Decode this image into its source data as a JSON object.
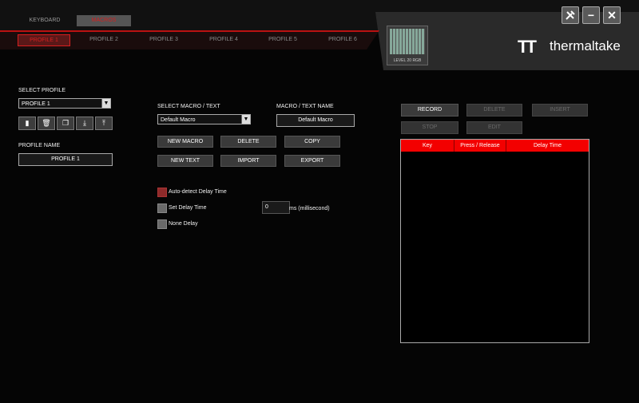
{
  "main_tabs": [
    {
      "label": "KEYBOARD"
    },
    {
      "label": "MACROS"
    }
  ],
  "profile_tabs": [
    {
      "label": "PROFILE 1"
    },
    {
      "label": "PROFILE 2"
    },
    {
      "label": "PROFILE 3"
    },
    {
      "label": "PROFILE 4"
    },
    {
      "label": "PROFILE 5"
    },
    {
      "label": "PROFILE 6"
    }
  ],
  "device": {
    "label": "LEVEL 20 RGB"
  },
  "brand": {
    "name": "thermaltake",
    "accent": "#f30000"
  },
  "window_controls": [
    {
      "icon": "tools-icon"
    },
    {
      "icon": "minimize-icon"
    },
    {
      "icon": "close-icon"
    }
  ],
  "select_profile": {
    "label": "SELECT PROFILE",
    "value": "PROFILE 1",
    "icons": [
      "save-icon",
      "trash-icon",
      "copy-icon",
      "download-icon",
      "upload-icon"
    ]
  },
  "profile_name": {
    "label": "PROFILE NAME",
    "value": "PROFILE 1"
  },
  "macro": {
    "select_label": "SELECT MACRO / TEXT",
    "select_value": "Default Macro",
    "name_label": "MACRO / TEXT NAME",
    "name_value": "Default Macro",
    "buttons": {
      "new_macro": "NEW MACRO",
      "delete": "DELETE",
      "copy": "COPY",
      "new_text": "NEW TEXT",
      "import": "IMPORT",
      "export": "EXPORT"
    }
  },
  "delay": {
    "auto_detect": "Auto-detect Delay Time",
    "set_delay": "Set Delay Time",
    "none_delay": "None Delay",
    "delay_value": "0",
    "unit": "ms (millisecond)"
  },
  "record": {
    "record": "RECORD",
    "delete": "DELETE",
    "insert": "INSERT",
    "stop": "STOP",
    "edit": "EDIT"
  },
  "table": {
    "columns": [
      "Key",
      "Press / Release",
      "Delay Time"
    ]
  }
}
